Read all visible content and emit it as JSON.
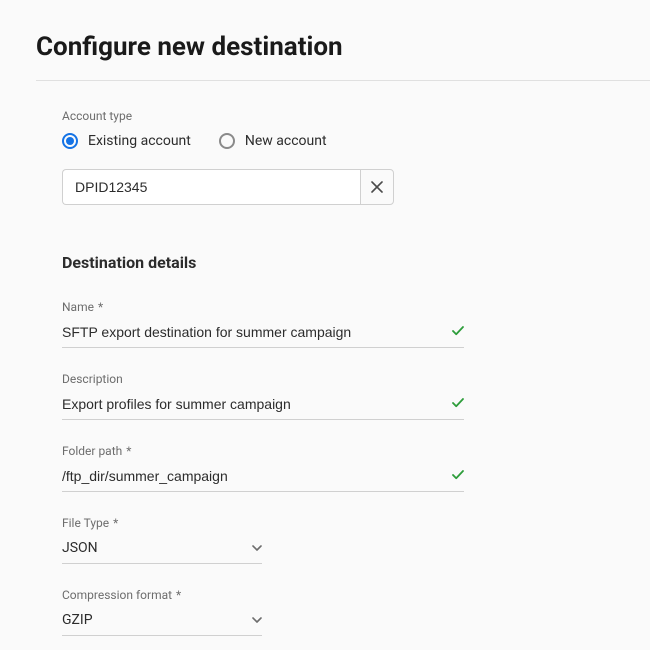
{
  "title": "Configure new destination",
  "accountType": {
    "label": "Account type",
    "options": {
      "existing": "Existing account",
      "new": "New account"
    },
    "selected": "existing"
  },
  "accountField": {
    "value": "DPID12345"
  },
  "details": {
    "heading": "Destination details",
    "fields": {
      "name": {
        "label": "Name",
        "required": true,
        "value": "SFTP export destination for summer campaign",
        "valid": true
      },
      "description": {
        "label": "Description",
        "required": false,
        "value": "Export profiles for summer campaign",
        "valid": true
      },
      "folderPath": {
        "label": "Folder path",
        "required": true,
        "value": "/ftp_dir/summer_campaign",
        "valid": true
      },
      "fileType": {
        "label": "File Type",
        "required": true,
        "value": "JSON"
      },
      "compression": {
        "label": "Compression format",
        "required": true,
        "value": "GZIP"
      }
    }
  },
  "glyphs": {
    "asterisk": "*"
  }
}
